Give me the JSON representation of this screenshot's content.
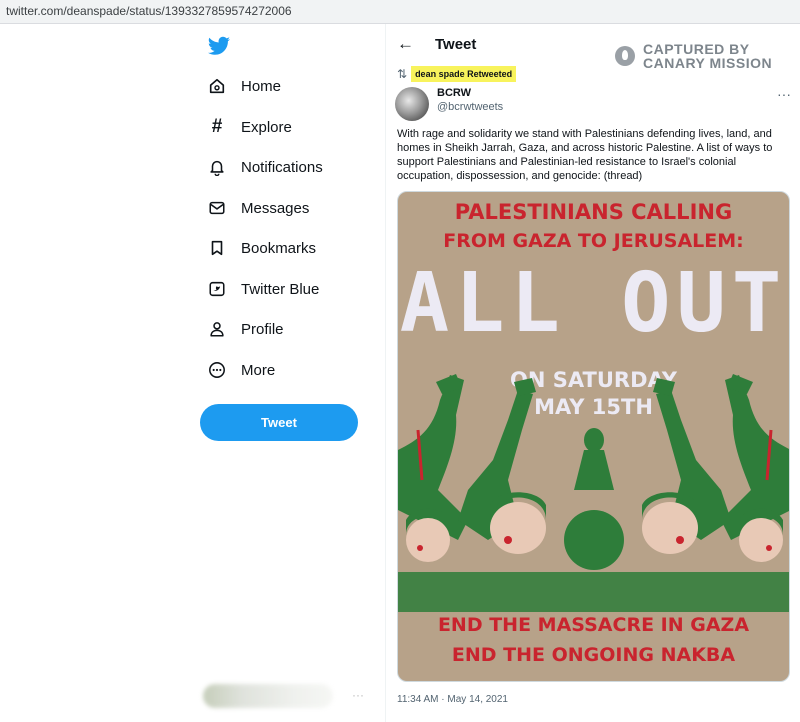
{
  "url": "twitter.com/deanspade/status/1393327859574272006",
  "sidebar": {
    "items": [
      {
        "label": "Home",
        "icon": "home-icon"
      },
      {
        "label": "Explore",
        "icon": "hashtag-icon"
      },
      {
        "label": "Notifications",
        "icon": "bell-icon"
      },
      {
        "label": "Messages",
        "icon": "envelope-icon"
      },
      {
        "label": "Bookmarks",
        "icon": "bookmark-icon"
      },
      {
        "label": "Twitter Blue",
        "icon": "twitter-blue-icon"
      },
      {
        "label": "Profile",
        "icon": "person-icon"
      },
      {
        "label": "More",
        "icon": "more-circle-icon"
      }
    ],
    "tweet_button": "Tweet"
  },
  "header": {
    "title": "Tweet"
  },
  "watermark": {
    "line1": "CAPTURED BY",
    "line2": "CANARY MISSION"
  },
  "tweet": {
    "retweeted_by": "dean spade Retweeted",
    "author_name": "BCRW",
    "author_handle": "@bcrwtweets",
    "text": "With rage and solidarity we stand with Palestinians defending lives, land, and homes in Sheikh Jarrah, Gaza, and across historic Palestine. A list of ways to support Palestinians and Palestinian-led resistance to Israel's colonial occupation, dispossession, and genocide: (thread)",
    "timestamp": "11:34 AM · May 14, 2021"
  },
  "poster": {
    "line1": "PALESTINIANS CALLING",
    "line2": "FROM GAZA TO JERUSALEM:",
    "headline": "ALL OUT",
    "date1": "ON SATURDAY",
    "date2": "MAY 15TH",
    "bottom1": "END THE MASSACRE IN GAZA",
    "bottom2": "END THE ONGOING NAKBA"
  },
  "colors": {
    "accent": "#1d9bf0",
    "highlight": "#f8f35c",
    "poster_red": "#c9242e",
    "poster_green": "#2e7d3a",
    "poster_bg": "#b7a289"
  }
}
